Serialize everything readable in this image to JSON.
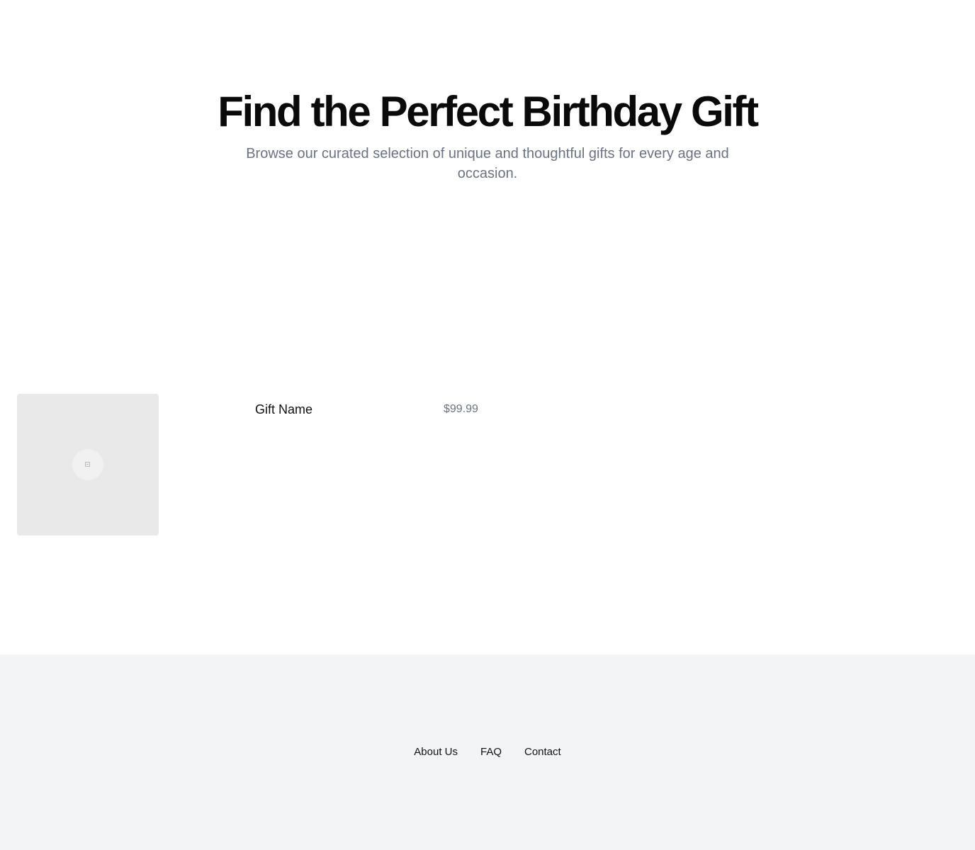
{
  "hero": {
    "title": "Find the Perfect Birthday Gift",
    "subtitle": "Browse our curated selection of unique and thoughtful gifts for every age and occasion."
  },
  "products": [
    {
      "name": "Gift Name",
      "price": "$99.99",
      "image_icon": "image-placeholder-icon"
    }
  ],
  "footer": {
    "links": [
      {
        "label": "About Us"
      },
      {
        "label": "FAQ"
      },
      {
        "label": "Contact"
      }
    ]
  },
  "colors": {
    "title": "#0a0a0a",
    "muted_text": "#6b7280",
    "image_placeholder": "#e9e9ea",
    "footer_background": "#f3f4f6"
  }
}
